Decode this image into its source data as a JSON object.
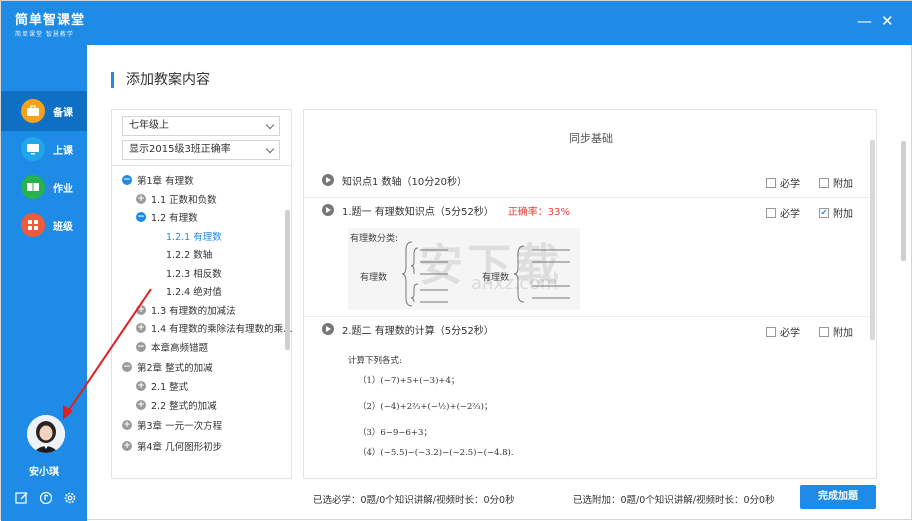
{
  "app": {
    "logo_main": "简单智课堂",
    "logo_sub": "简单课堂 智慧教学",
    "minimize_glyph": "—",
    "close_glyph": "✕"
  },
  "sidebar": {
    "items": [
      {
        "label": "备课",
        "icon": "briefcase-icon",
        "color": "#f4a21c"
      },
      {
        "label": "上课",
        "icon": "screen-icon",
        "color": "#21a7e8"
      },
      {
        "label": "作业",
        "icon": "book-icon",
        "color": "#26b34e"
      },
      {
        "label": "班级",
        "icon": "grid-icon",
        "color": "#ef5a3a"
      }
    ],
    "username": "安小琪"
  },
  "page": {
    "title": "添加教案内容"
  },
  "filters": {
    "grade": "七年级上",
    "class": "显示2015级3班正确率"
  },
  "tree": [
    {
      "label": "第1章  有理数",
      "toggle": "−"
    },
    {
      "label": "1.1 正数和负数",
      "toggle": "+"
    },
    {
      "label": "1.2 有理数",
      "toggle": "−"
    },
    {
      "label": "1.2.1 有理数",
      "toggle": ""
    },
    {
      "label": "1.2.2 数轴",
      "toggle": ""
    },
    {
      "label": "1.2.3 相反数",
      "toggle": ""
    },
    {
      "label": "1.2.4 绝对值",
      "toggle": ""
    },
    {
      "label": "1.3 有理数的加减法",
      "toggle": "+"
    },
    {
      "label": "1.4 有理数的乘除法有理数的乘…",
      "toggle": "+"
    },
    {
      "label": "本章高频错题",
      "toggle": "−"
    },
    {
      "label": "第2章  整式的加减",
      "toggle": "−"
    },
    {
      "label": "2.1 整式",
      "toggle": "+"
    },
    {
      "label": "2.2 整式的加减",
      "toggle": "+"
    },
    {
      "label": "第3章  一元一次方程",
      "toggle": "+"
    },
    {
      "label": "第4章  几何图形初步",
      "toggle": "+"
    }
  ],
  "content": {
    "section_title": "同步基础",
    "rows": [
      {
        "text": "知识点1  数轴（10分20秒）",
        "rate": "",
        "must": "必学",
        "extra": "附加",
        "extra_checked": false
      },
      {
        "text": "1.题一  有理数知识点（5分52秒）",
        "rate": "正确率：33%",
        "must": "必学",
        "extra": "附加",
        "extra_checked": true
      },
      {
        "text": "2.题二  有理数的计算（5分52秒）",
        "rate": "",
        "must": "必学",
        "extra": "附加",
        "extra_checked": false
      }
    ],
    "diagram": {
      "title": "有理数分类:",
      "left_label": "有理数",
      "right_label": "有理数"
    },
    "exercise": {
      "heading": "计算下列各式:",
      "items": [
        "（1）(−7)+5+(−3)+4；",
        "（2）(−4)+2⅔+(−½)+(−2⅔)；",
        "（3）6−9−6+3；",
        "（4）(−5.5)−(−3.2)−(−2.5)−(−4.8)."
      ]
    }
  },
  "footer": {
    "selected_must": "已选必学：0题/0个知识讲解/视频时长：0分0秒",
    "selected_extra": "已选附加：0题/0个知识讲解/视频时长：0分0秒",
    "finish_button": "完成加题"
  },
  "watermark": {
    "text": "安下载",
    "sub": "anxz.com"
  }
}
